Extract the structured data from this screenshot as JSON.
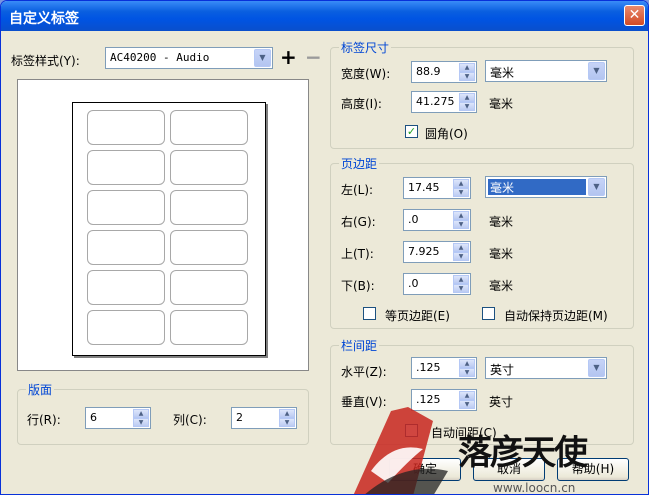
{
  "window": {
    "title": "自定义标签"
  },
  "label_style": {
    "label": "标签样式(Y):",
    "value": "AC40200 - Audio"
  },
  "label_size": {
    "title": "标签尺寸",
    "width_label": "宽度(W):",
    "width_value": "88.9",
    "width_unit": "毫米",
    "height_label": "高度(I):",
    "height_value": "41.275",
    "height_unit": "毫米",
    "rounded_label": "圆角(O)",
    "rounded_checked": true
  },
  "margins": {
    "title": "页边距",
    "left_label": "左(L):",
    "left_value": "17.45",
    "left_unit": "毫米",
    "right_label": "右(G):",
    "right_value": ".0",
    "right_unit": "毫米",
    "top_label": "上(T):",
    "top_value": "7.925",
    "top_unit": "毫米",
    "bottom_label": "下(B):",
    "bottom_value": ".0",
    "bottom_unit": "毫米",
    "equal_label": "等页边距(E)",
    "auto_label": "自动保持页边距(M)"
  },
  "gutter": {
    "title": "栏间距",
    "horizontal_label": "水平(Z):",
    "horizontal_value": ".125",
    "horizontal_unit": "英寸",
    "vertical_label": "垂直(V):",
    "vertical_value": ".125",
    "vertical_unit": "英寸",
    "auto_label": "自动间距(C)"
  },
  "layout": {
    "title": "版面",
    "rows_label": "行(R):",
    "rows_value": "6",
    "cols_label": "列(C):",
    "cols_value": "2"
  },
  "buttons": {
    "ok": "确定",
    "cancel": "取消",
    "help": "帮助(H)"
  },
  "watermark": {
    "text": "落彦天使",
    "url": "www.loocn.cn"
  },
  "colors": {
    "title_bar": "#0054e3",
    "group_title": "#0046d5",
    "dialog_bg": "#ece9d8"
  }
}
